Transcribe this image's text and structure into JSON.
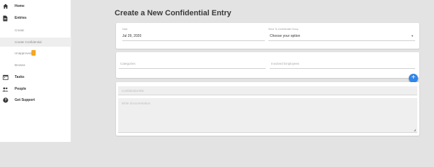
{
  "sidebar": {
    "home": "Home",
    "entries": "Entries",
    "entries_sub": {
      "create": "Create",
      "create_confidential": "Create Confidential",
      "unapproved": "Unapproved",
      "browse": "Browse"
    },
    "tasks": "Tasks",
    "people": "People",
    "get_support": "Get Support"
  },
  "main": {
    "title": "Create a New Confidential Entry",
    "date_label": "Date",
    "date_value": "Jul 29, 2020",
    "group_label": "Send To Confidential Group",
    "group_value": "Choose your option",
    "categories_placeholder": "Categories",
    "employees_placeholder": "Involved Employees",
    "entry_title_placeholder": "Confidential title",
    "documentation_placeholder": "Write documentation"
  },
  "colors": {
    "accent": "#2f86e8",
    "badge": "#f5a623"
  },
  "icons": {
    "home": "home-icon",
    "entries": "document-icon",
    "tasks": "calendar-icon",
    "people": "people-icon",
    "support": "help-icon",
    "add": "plus-icon"
  }
}
